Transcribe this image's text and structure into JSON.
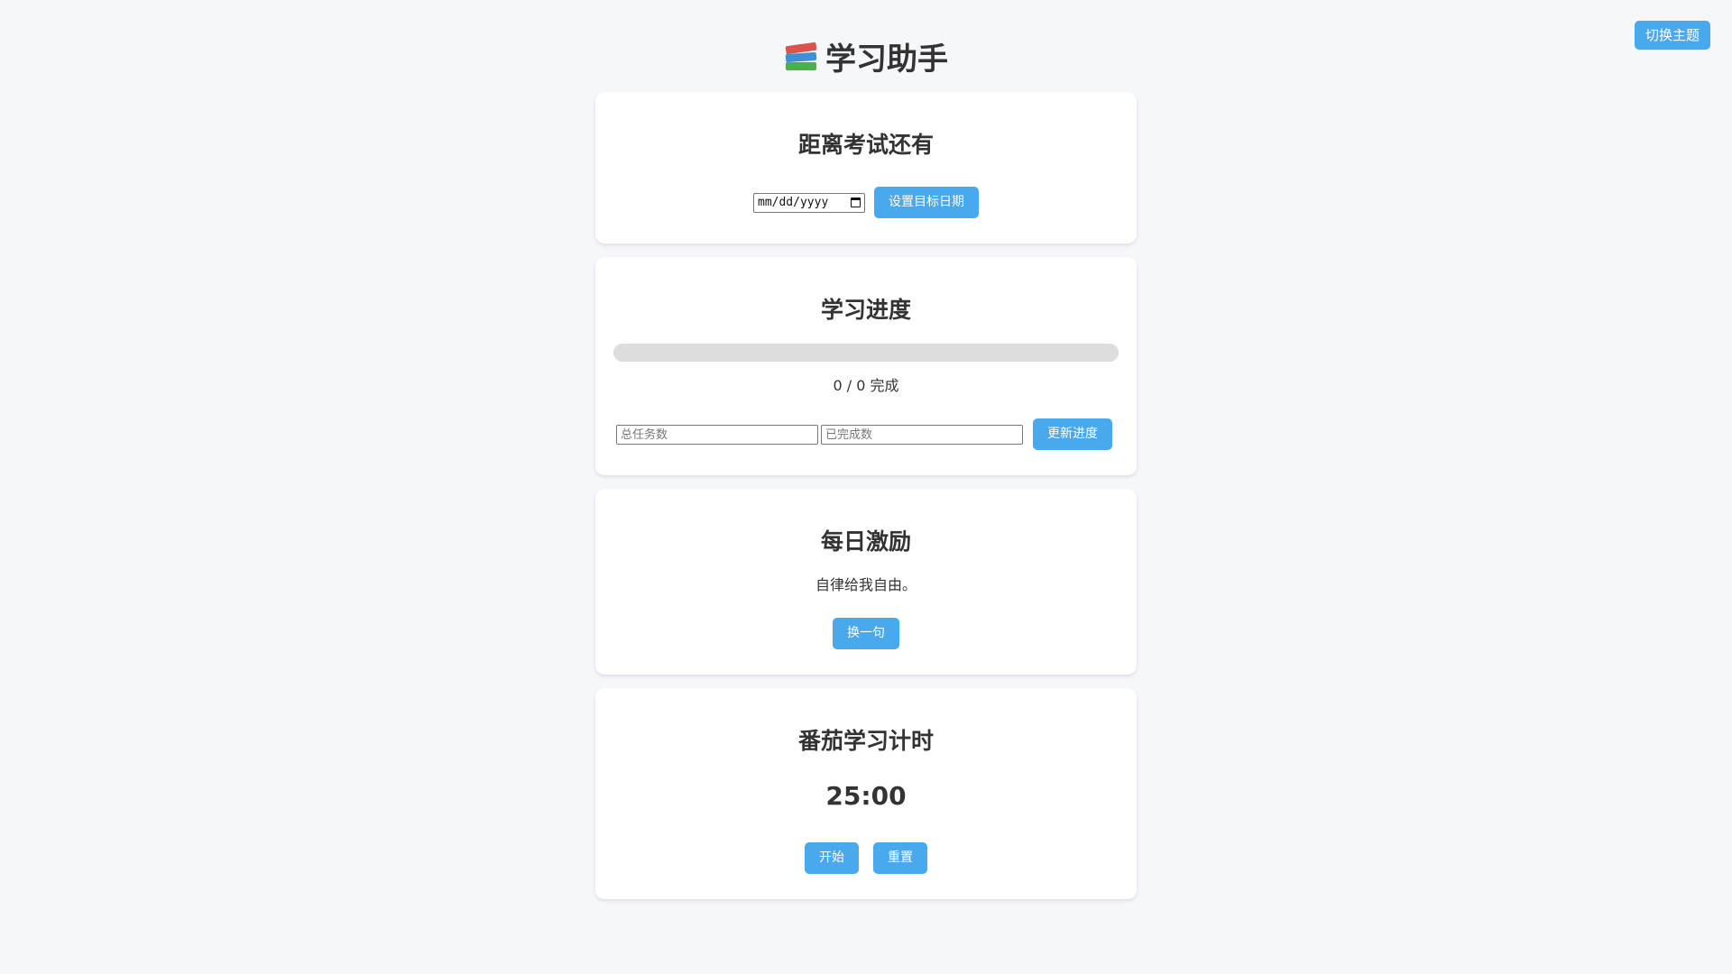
{
  "header": {
    "theme_button": "切换主题",
    "title": "学习助手"
  },
  "exam_card": {
    "title": "距离考试还有",
    "date_value": "mm/dd/yyyy",
    "set_date_button": "设置目标日期"
  },
  "progress_card": {
    "title": "学习进度",
    "progress_fraction": 0,
    "status_text": "0 / 0 完成",
    "total_placeholder": "总任务数",
    "done_placeholder": "已完成数",
    "update_button": "更新进度"
  },
  "quote_card": {
    "title": "每日激励",
    "quote": "自律给我自由。",
    "next_button": "换一句"
  },
  "timer_card": {
    "title": "番茄学习计时",
    "time": "25:00",
    "start_button": "开始",
    "reset_button": "重置"
  },
  "colors": {
    "accent": "#4aa8ec",
    "background": "#f5f7fa",
    "card": "#ffffff",
    "track": "#dddddd"
  }
}
